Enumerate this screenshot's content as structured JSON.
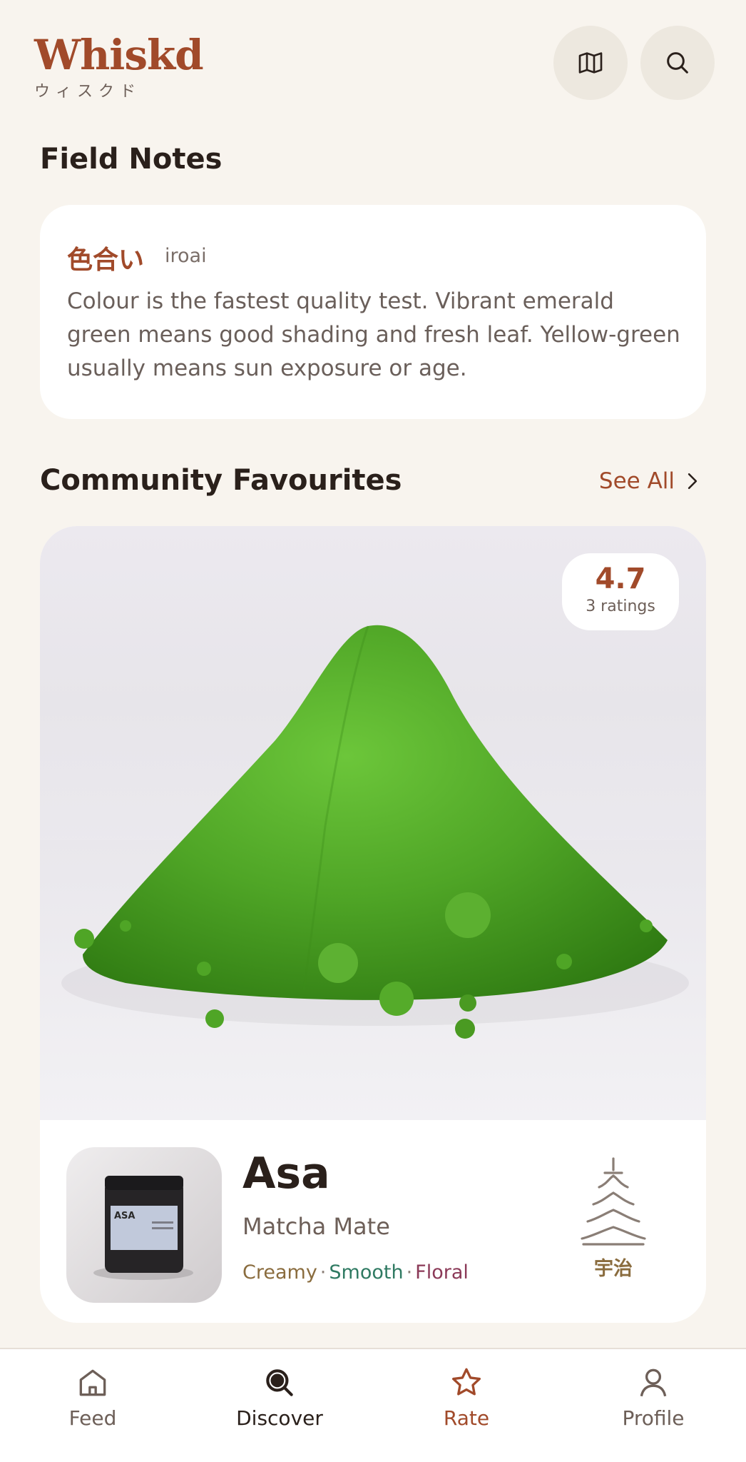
{
  "header": {
    "brand": "Whiskd",
    "brand_sub": "ウィスクド",
    "map_icon": "map-icon",
    "search_icon": "search-icon"
  },
  "field_notes": {
    "title": "Field Notes",
    "term": "色合い",
    "romaji": "iroai",
    "body": "Colour is the fastest quality test. Vibrant emerald green means good shading and fresh leaf. Yellow-green usually means sun exposure or age."
  },
  "favourites": {
    "title": "Community Favourites",
    "see_all": "See All",
    "item": {
      "rating": "4.7",
      "rating_count": "3 ratings",
      "name": "Asa",
      "brand": "Matcha Mate",
      "notes": [
        "Creamy",
        "Smooth",
        "Floral"
      ],
      "jar_label": "ASA",
      "origin": "宇治",
      "origin_icon": "pagoda-icon"
    }
  },
  "tabs": [
    {
      "label": "Feed",
      "icon": "home-icon",
      "color": "#6d5f58"
    },
    {
      "label": "Discover",
      "icon": "discover-icon",
      "color": "#2a201b"
    },
    {
      "label": "Rate",
      "icon": "star-icon",
      "color": "#a14a2a"
    },
    {
      "label": "Profile",
      "icon": "profile-icon",
      "color": "#6d5f58"
    }
  ],
  "colors": {
    "background": "#f8f4ee",
    "accent": "#a14a2a",
    "card": "#ffffff",
    "matcha_green": "#4a9a22"
  }
}
